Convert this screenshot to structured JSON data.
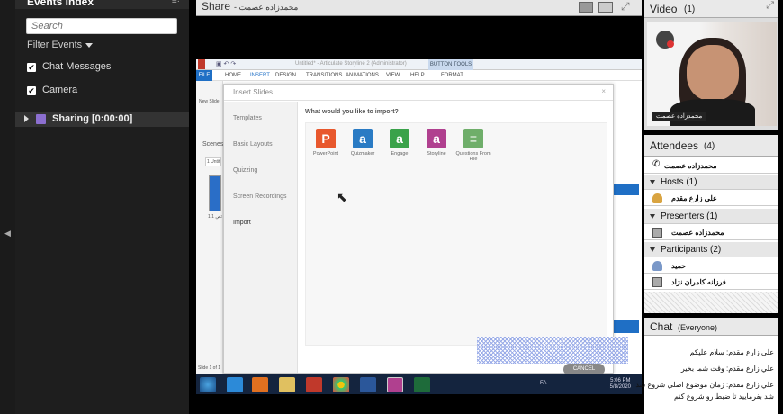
{
  "events": {
    "title": "Events Index",
    "search_placeholder": "Search",
    "filter_label": "Filter Events",
    "checks": [
      "Chat Messages",
      "Camera"
    ],
    "sharing_label": "Sharing [0:00:00]"
  },
  "share": {
    "title": "Share",
    "presenter": "- محمدزاده عصمت"
  },
  "app": {
    "window_title": "Untitled* - Articulate Storyline 2 (Administrator)",
    "button_tools": "BUTTON TOOLS",
    "format_tab": "FORMAT",
    "ribbon_tabs": [
      "FILE",
      "HOME",
      "INSERT",
      "DESIGN",
      "TRANSITIONS",
      "ANIMATIONS",
      "VIEW",
      "HELP"
    ],
    "left_labels": [
      "New Slide",
      "Scenes",
      "1 Untit",
      "1.1 ثص"
    ],
    "slide_status": "Slide 1 of 1",
    "dialog": {
      "title": "Insert Slides",
      "close": "×",
      "nav": [
        "Templates",
        "Basic Layouts",
        "Quizzing",
        "Screen Recordings",
        "Import"
      ],
      "question": "What would you like to import?",
      "tiles": [
        {
          "label": "PowerPoint",
          "glyph": "P",
          "color": "#e8582d"
        },
        {
          "label": "Quizmaker",
          "glyph": "a",
          "color": "#2a7bc4"
        },
        {
          "label": "Engage",
          "glyph": "a",
          "color": "#3aa24a"
        },
        {
          "label": "Storyline",
          "glyph": "a",
          "color": "#b0408f"
        },
        {
          "label": "Questions From File",
          "glyph": "≡",
          "color": "#6fae6a"
        }
      ],
      "cancel": "CANCEL"
    },
    "taskbar": {
      "lang": "FA",
      "time": "5:06 PM",
      "date": "5/8/2020"
    }
  },
  "video": {
    "title": "Video",
    "count": "(1)",
    "name": "محمدزاده عصمت"
  },
  "attendees": {
    "title": "Attendees",
    "count": "(4)",
    "me": "محمدزاده عصمت",
    "groups": [
      {
        "label": "Hosts (1)",
        "members": [
          "علي زارع مقدم"
        ]
      },
      {
        "label": "Presenters (1)",
        "members": [
          "محمدزاده عصمت"
        ]
      },
      {
        "label": "Participants (2)",
        "members": [
          "حميد",
          "فرزانه کامران نژاد"
        ]
      }
    ]
  },
  "chat": {
    "title": "Chat",
    "scope": "(Everyone)",
    "messages": [
      "علي زارع مقدم: سلام عليکم",
      "علي زارع مقدم: وقت شما بخير",
      "علي زارع مقدم: زمان موضوع اصلي شروع شد",
      "شد بفرماييد تا ضبط رو شروع کنم"
    ]
  },
  "colors": {
    "accent": "#1f6fc5",
    "panel_dark": "#1e1e1e",
    "pod_header": "#e9e9e9"
  }
}
